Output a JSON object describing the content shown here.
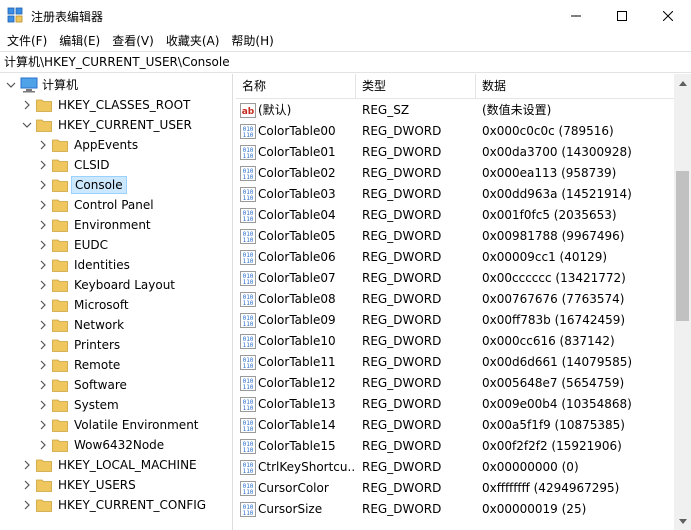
{
  "window": {
    "title": "注册表编辑器",
    "minimize_icon": "minimize-icon",
    "maximize_icon": "maximize-icon",
    "close_icon": "close-icon"
  },
  "menu": [
    {
      "label": "文件(F)"
    },
    {
      "label": "编辑(E)"
    },
    {
      "label": "查看(V)"
    },
    {
      "label": "收藏夹(A)"
    },
    {
      "label": "帮助(H)"
    }
  ],
  "address": "计算机\\HKEY_CURRENT_USER\\Console",
  "tree": {
    "root": "计算机",
    "items": [
      {
        "label": "HKEY_CLASSES_ROOT",
        "level": 1,
        "expanded": false
      },
      {
        "label": "HKEY_CURRENT_USER",
        "level": 1,
        "expanded": true
      },
      {
        "label": "AppEvents",
        "level": 2,
        "expanded": false
      },
      {
        "label": "CLSID",
        "level": 2,
        "expanded": false
      },
      {
        "label": "Console",
        "level": 2,
        "expanded": false,
        "selected": true
      },
      {
        "label": "Control Panel",
        "level": 2,
        "expanded": false
      },
      {
        "label": "Environment",
        "level": 2,
        "expanded": false
      },
      {
        "label": "EUDC",
        "level": 2,
        "expanded": false
      },
      {
        "label": "Identities",
        "level": 2,
        "expanded": false
      },
      {
        "label": "Keyboard Layout",
        "level": 2,
        "expanded": false
      },
      {
        "label": "Microsoft",
        "level": 2,
        "expanded": false
      },
      {
        "label": "Network",
        "level": 2,
        "expanded": false
      },
      {
        "label": "Printers",
        "level": 2,
        "expanded": false
      },
      {
        "label": "Remote",
        "level": 2,
        "expanded": false
      },
      {
        "label": "Software",
        "level": 2,
        "expanded": false
      },
      {
        "label": "System",
        "level": 2,
        "expanded": false
      },
      {
        "label": "Volatile Environment",
        "level": 2,
        "expanded": false
      },
      {
        "label": "Wow6432Node",
        "level": 2,
        "expanded": false
      },
      {
        "label": "HKEY_LOCAL_MACHINE",
        "level": 1,
        "expanded": false
      },
      {
        "label": "HKEY_USERS",
        "level": 1,
        "expanded": false
      },
      {
        "label": "HKEY_CURRENT_CONFIG",
        "level": 1,
        "expanded": false
      }
    ]
  },
  "list": {
    "columns": {
      "name": "名称",
      "type": "类型",
      "data": "数据"
    },
    "rows": [
      {
        "name": "(默认)",
        "type": "REG_SZ",
        "data": "(数值未设置)",
        "icon": "string-value-icon"
      },
      {
        "name": "ColorTable00",
        "type": "REG_DWORD",
        "data": "0x000c0c0c (789516)",
        "icon": "binary-value-icon"
      },
      {
        "name": "ColorTable01",
        "type": "REG_DWORD",
        "data": "0x00da3700 (14300928)",
        "icon": "binary-value-icon"
      },
      {
        "name": "ColorTable02",
        "type": "REG_DWORD",
        "data": "0x000ea113 (958739)",
        "icon": "binary-value-icon"
      },
      {
        "name": "ColorTable03",
        "type": "REG_DWORD",
        "data": "0x00dd963a (14521914)",
        "icon": "binary-value-icon"
      },
      {
        "name": "ColorTable04",
        "type": "REG_DWORD",
        "data": "0x001f0fc5 (2035653)",
        "icon": "binary-value-icon"
      },
      {
        "name": "ColorTable05",
        "type": "REG_DWORD",
        "data": "0x00981788 (9967496)",
        "icon": "binary-value-icon"
      },
      {
        "name": "ColorTable06",
        "type": "REG_DWORD",
        "data": "0x00009cc1 (40129)",
        "icon": "binary-value-icon"
      },
      {
        "name": "ColorTable07",
        "type": "REG_DWORD",
        "data": "0x00cccccc (13421772)",
        "icon": "binary-value-icon"
      },
      {
        "name": "ColorTable08",
        "type": "REG_DWORD",
        "data": "0x00767676 (7763574)",
        "icon": "binary-value-icon"
      },
      {
        "name": "ColorTable09",
        "type": "REG_DWORD",
        "data": "0x00ff783b (16742459)",
        "icon": "binary-value-icon"
      },
      {
        "name": "ColorTable10",
        "type": "REG_DWORD",
        "data": "0x000cc616 (837142)",
        "icon": "binary-value-icon"
      },
      {
        "name": "ColorTable11",
        "type": "REG_DWORD",
        "data": "0x00d6d661 (14079585)",
        "icon": "binary-value-icon"
      },
      {
        "name": "ColorTable12",
        "type": "REG_DWORD",
        "data": "0x005648e7 (5654759)",
        "icon": "binary-value-icon"
      },
      {
        "name": "ColorTable13",
        "type": "REG_DWORD",
        "data": "0x009e00b4 (10354868)",
        "icon": "binary-value-icon"
      },
      {
        "name": "ColorTable14",
        "type": "REG_DWORD",
        "data": "0x00a5f1f9 (10875385)",
        "icon": "binary-value-icon"
      },
      {
        "name": "ColorTable15",
        "type": "REG_DWORD",
        "data": "0x00f2f2f2 (15921906)",
        "icon": "binary-value-icon"
      },
      {
        "name": "CtrlKeyShortcu...",
        "type": "REG_DWORD",
        "data": "0x00000000 (0)",
        "icon": "binary-value-icon"
      },
      {
        "name": "CursorColor",
        "type": "REG_DWORD",
        "data": "0xffffffff (4294967295)",
        "icon": "binary-value-icon"
      },
      {
        "name": "CursorSize",
        "type": "REG_DWORD",
        "data": "0x00000019 (25)",
        "icon": "binary-value-icon"
      }
    ]
  },
  "colors": {
    "selection_bg": "#cce8ff",
    "selection_border": "#99d1ff",
    "folder": "#f0c75e",
    "icon_blue": "#2a6fce",
    "icon_red": "#c42b1c"
  }
}
